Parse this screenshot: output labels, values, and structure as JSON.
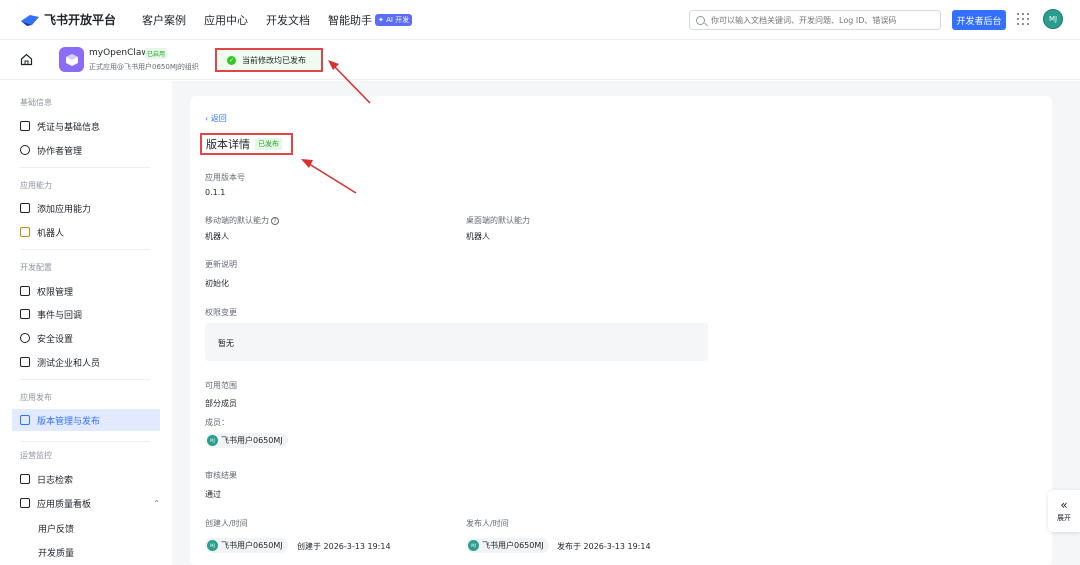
{
  "header": {
    "logo_text": "飞书开放平台",
    "nav": [
      "客户案例",
      "应用中心",
      "开发文档",
      "智能助手"
    ],
    "ai_badge": "✦ AI 开发",
    "search_placeholder": "你可以输入文档关键词、开发问题、Log ID、错误码",
    "dev_console": "开发者后台",
    "avatar": "MJ"
  },
  "app": {
    "name": "myOpenClaw",
    "tag": "已启用",
    "subtitle": "正式应用@飞书用户0650MJ的组织"
  },
  "toast": "当前修改均已发布",
  "sidebar": {
    "sections": [
      {
        "title": "基础信息",
        "items": [
          "凭证与基础信息",
          "协作者管理"
        ]
      },
      {
        "title": "应用能力",
        "items": [
          "添加应用能力",
          "机器人"
        ]
      },
      {
        "title": "开发配置",
        "items": [
          "权限管理",
          "事件与回调",
          "安全设置",
          "测试企业和人员"
        ]
      },
      {
        "title": "应用发布",
        "items": [
          "版本管理与发布"
        ]
      },
      {
        "title": "运营监控",
        "items": [
          "日志检索",
          "应用质量看板"
        ]
      }
    ],
    "sub_items": [
      "用户反馈",
      "开发质量"
    ],
    "active": "版本管理与发布"
  },
  "detail": {
    "back": "返回",
    "title": "版本详情",
    "status": "已发布",
    "version_label": "应用版本号",
    "version": "0.1.1",
    "mobile_label": "移动端的默认能力",
    "mobile_value": "机器人",
    "desktop_label": "桌面端的默认能力",
    "desktop_value": "机器人",
    "notes_label": "更新说明",
    "notes_value": "初始化",
    "perm_label": "权限变更",
    "perm_value": "暂无",
    "scope_label": "可用范围",
    "scope_value": "部分成员",
    "members_label": "成员：",
    "member": "飞书用户0650MJ",
    "review_label": "审核结果",
    "review_value": "通过",
    "creator_label": "创建人/时间",
    "creator": "飞书用户0650MJ",
    "created": "创建于 2026-3-13 19:14",
    "publisher_label": "发布人/时间",
    "publisher": "飞书用户0650MJ",
    "published": "发布于 2026-3-13 19:14",
    "chip_avatar": "MJ"
  },
  "expand": {
    "icon": "«",
    "label": "展开"
  }
}
